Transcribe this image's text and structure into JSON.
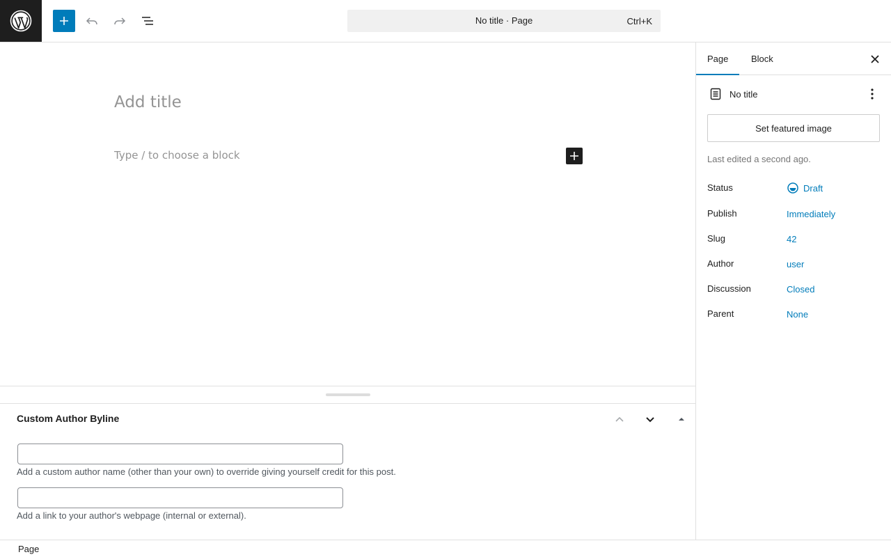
{
  "header": {
    "logo_icon": "wordpress-logo",
    "inserter_icon": "plus-icon",
    "undo_icon": "undo-icon",
    "redo_icon": "redo-icon",
    "document_overview_icon": "list-view-icon",
    "command_bar": {
      "title": "No title · Page",
      "shortcut": "Ctrl+K"
    }
  },
  "editor": {
    "title_placeholder": "Add title",
    "block_placeholder": "Type / to choose a block"
  },
  "metabox": {
    "title": "Custom Author Byline",
    "fields": [
      {
        "value": "",
        "description": "Add a custom author name (other than your own) to override giving yourself credit for this post."
      },
      {
        "value": "",
        "description": "Add a link to your author's webpage (internal or external)."
      }
    ]
  },
  "footer": {
    "breadcrumb": "Page"
  },
  "sidebar": {
    "tabs": [
      {
        "label": "Page",
        "active": true
      },
      {
        "label": "Block",
        "active": false
      }
    ],
    "document_title": "No title",
    "featured_image_button": "Set featured image",
    "last_edited": "Last edited a second ago.",
    "meta": [
      {
        "label": "Status",
        "value": "Draft"
      },
      {
        "label": "Publish",
        "value": "Immediately"
      },
      {
        "label": "Slug",
        "value": "42"
      },
      {
        "label": "Author",
        "value": "user"
      },
      {
        "label": "Discussion",
        "value": "Closed"
      },
      {
        "label": "Parent",
        "value": "None"
      }
    ]
  },
  "colors": {
    "accent": "#007cba",
    "dark": "#1e1e1e",
    "placeholder": "#949494",
    "border": "#e0e0e0"
  }
}
